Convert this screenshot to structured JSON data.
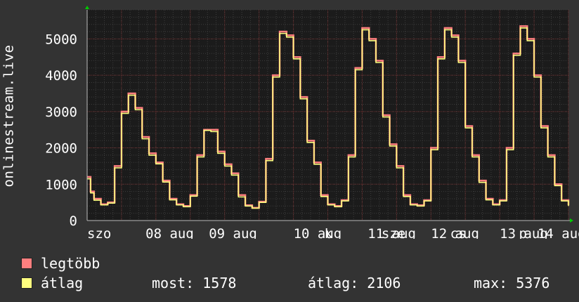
{
  "chart_data": {
    "type": "line",
    "ylabel": "onlinestream.live",
    "ylim": [
      0,
      5800
    ],
    "yticks": [
      0,
      1000,
      2000,
      3000,
      4000,
      5000
    ],
    "xlim": [
      0,
      7
    ],
    "xticks": [
      {
        "x": 0.0,
        "label": "szo"
      },
      {
        "x": 0.85,
        "label": "08 aug"
      },
      {
        "x": 1.77,
        "label": "09 aug"
      },
      {
        "x": 3.0,
        "label": "10 aug"
      },
      {
        "x": 3.45,
        "label": "k"
      },
      {
        "x": 4.08,
        "label": "11 aug"
      },
      {
        "x": 4.28,
        "label": "sze"
      },
      {
        "x": 5.0,
        "label": "12 aug"
      },
      {
        "x": 5.28,
        "label": "cs"
      },
      {
        "x": 6.0,
        "label": "13 aug"
      },
      {
        "x": 6.28,
        "label": "p"
      },
      {
        "x": 6.55,
        "label": "14 aug"
      }
    ],
    "grid": true,
    "series": [
      {
        "name": "legtöbb",
        "color": "#ff7f7f",
        "x": [
          0.0,
          0.05,
          0.1,
          0.2,
          0.3,
          0.4,
          0.5,
          0.6,
          0.7,
          0.8,
          0.9,
          1.0,
          1.1,
          1.2,
          1.3,
          1.4,
          1.5,
          1.6,
          1.7,
          1.8,
          1.9,
          2.0,
          2.1,
          2.2,
          2.3,
          2.4,
          2.5,
          2.6,
          2.7,
          2.8,
          2.9,
          3.0,
          3.1,
          3.2,
          3.3,
          3.4,
          3.5,
          3.6,
          3.7,
          3.8,
          3.9,
          4.0,
          4.1,
          4.2,
          4.3,
          4.4,
          4.5,
          4.6,
          4.7,
          4.8,
          4.9,
          5.0,
          5.1,
          5.2,
          5.3,
          5.4,
          5.5,
          5.6,
          5.7,
          5.8,
          5.9,
          6.0,
          6.1,
          6.2,
          6.3,
          6.4,
          6.5,
          6.6,
          6.7,
          6.8,
          6.9,
          7.0
        ],
        "values": [
          1200,
          800,
          600,
          450,
          500,
          1500,
          3000,
          3500,
          3100,
          2300,
          1850,
          1600,
          1100,
          600,
          450,
          400,
          700,
          1800,
          2500,
          2500,
          1900,
          1550,
          1300,
          700,
          420,
          350,
          520,
          1700,
          4000,
          5200,
          5100,
          4500,
          3400,
          2200,
          1600,
          700,
          450,
          400,
          560,
          1800,
          4200,
          5300,
          5000,
          4400,
          2900,
          2100,
          1500,
          700,
          450,
          420,
          560,
          2000,
          4500,
          5300,
          5100,
          4400,
          2600,
          1800,
          1100,
          600,
          450,
          560,
          2000,
          4600,
          5350,
          5000,
          4000,
          2600,
          1800,
          1000,
          560,
          420
        ]
      },
      {
        "name": "átlag",
        "color": "#ffff7f",
        "x": [
          0.0,
          0.05,
          0.1,
          0.2,
          0.3,
          0.4,
          0.5,
          0.6,
          0.7,
          0.8,
          0.9,
          1.0,
          1.1,
          1.2,
          1.3,
          1.4,
          1.5,
          1.6,
          1.7,
          1.8,
          1.9,
          2.0,
          2.1,
          2.2,
          2.3,
          2.4,
          2.5,
          2.6,
          2.7,
          2.8,
          2.9,
          3.0,
          3.1,
          3.2,
          3.3,
          3.4,
          3.5,
          3.6,
          3.7,
          3.8,
          3.9,
          4.0,
          4.1,
          4.2,
          4.3,
          4.4,
          4.5,
          4.6,
          4.7,
          4.8,
          4.9,
          5.0,
          5.1,
          5.2,
          5.3,
          5.4,
          5.5,
          5.6,
          5.7,
          5.8,
          5.9,
          6.0,
          6.1,
          6.2,
          6.3,
          6.4,
          6.5,
          6.6,
          6.7,
          6.8,
          6.9,
          7.0
        ],
        "values": [
          1150,
          760,
          560,
          430,
          480,
          1450,
          2950,
          3450,
          3050,
          2250,
          1800,
          1560,
          1060,
          570,
          430,
          380,
          670,
          1750,
          2480,
          2450,
          1850,
          1500,
          1250,
          650,
          400,
          340,
          500,
          1650,
          3950,
          5150,
          5050,
          4450,
          3350,
          2150,
          1550,
          660,
          430,
          380,
          540,
          1750,
          4150,
          5250,
          4950,
          4350,
          2850,
          2050,
          1450,
          660,
          430,
          400,
          540,
          1950,
          4450,
          5250,
          5050,
          4350,
          2550,
          1750,
          1050,
          570,
          430,
          540,
          1950,
          4550,
          5300,
          4950,
          3950,
          2550,
          1750,
          960,
          540,
          400
        ]
      }
    ]
  },
  "legend": {
    "items": [
      {
        "label": "legtöbb",
        "color": "#ff7f7f"
      },
      {
        "label": "átlag",
        "color": "#ffff7f"
      }
    ],
    "stats": [
      {
        "label": "most:",
        "value": "1578"
      },
      {
        "label": "átlag:",
        "value": "2106"
      },
      {
        "label": "max:",
        "value": "5376"
      }
    ]
  }
}
